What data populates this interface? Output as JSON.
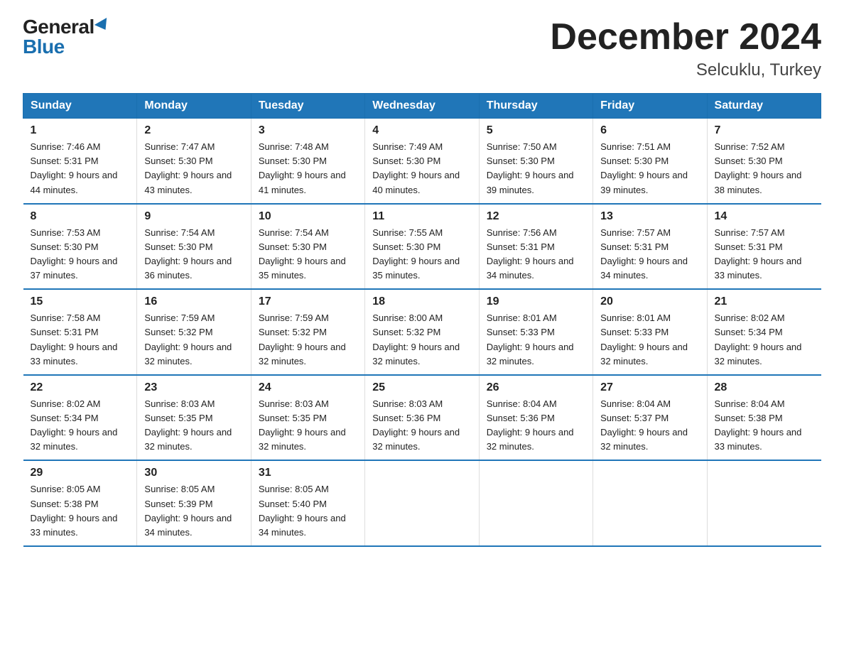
{
  "logo": {
    "general": "General",
    "blue": "Blue"
  },
  "title": "December 2024",
  "subtitle": "Selcuklu, Turkey",
  "days_header": [
    "Sunday",
    "Monday",
    "Tuesday",
    "Wednesday",
    "Thursday",
    "Friday",
    "Saturday"
  ],
  "weeks": [
    [
      {
        "day": "1",
        "sunrise": "7:46 AM",
        "sunset": "5:31 PM",
        "daylight": "9 hours and 44 minutes."
      },
      {
        "day": "2",
        "sunrise": "7:47 AM",
        "sunset": "5:30 PM",
        "daylight": "9 hours and 43 minutes."
      },
      {
        "day": "3",
        "sunrise": "7:48 AM",
        "sunset": "5:30 PM",
        "daylight": "9 hours and 41 minutes."
      },
      {
        "day": "4",
        "sunrise": "7:49 AM",
        "sunset": "5:30 PM",
        "daylight": "9 hours and 40 minutes."
      },
      {
        "day": "5",
        "sunrise": "7:50 AM",
        "sunset": "5:30 PM",
        "daylight": "9 hours and 39 minutes."
      },
      {
        "day": "6",
        "sunrise": "7:51 AM",
        "sunset": "5:30 PM",
        "daylight": "9 hours and 39 minutes."
      },
      {
        "day": "7",
        "sunrise": "7:52 AM",
        "sunset": "5:30 PM",
        "daylight": "9 hours and 38 minutes."
      }
    ],
    [
      {
        "day": "8",
        "sunrise": "7:53 AM",
        "sunset": "5:30 PM",
        "daylight": "9 hours and 37 minutes."
      },
      {
        "day": "9",
        "sunrise": "7:54 AM",
        "sunset": "5:30 PM",
        "daylight": "9 hours and 36 minutes."
      },
      {
        "day": "10",
        "sunrise": "7:54 AM",
        "sunset": "5:30 PM",
        "daylight": "9 hours and 35 minutes."
      },
      {
        "day": "11",
        "sunrise": "7:55 AM",
        "sunset": "5:30 PM",
        "daylight": "9 hours and 35 minutes."
      },
      {
        "day": "12",
        "sunrise": "7:56 AM",
        "sunset": "5:31 PM",
        "daylight": "9 hours and 34 minutes."
      },
      {
        "day": "13",
        "sunrise": "7:57 AM",
        "sunset": "5:31 PM",
        "daylight": "9 hours and 34 minutes."
      },
      {
        "day": "14",
        "sunrise": "7:57 AM",
        "sunset": "5:31 PM",
        "daylight": "9 hours and 33 minutes."
      }
    ],
    [
      {
        "day": "15",
        "sunrise": "7:58 AM",
        "sunset": "5:31 PM",
        "daylight": "9 hours and 33 minutes."
      },
      {
        "day": "16",
        "sunrise": "7:59 AM",
        "sunset": "5:32 PM",
        "daylight": "9 hours and 32 minutes."
      },
      {
        "day": "17",
        "sunrise": "7:59 AM",
        "sunset": "5:32 PM",
        "daylight": "9 hours and 32 minutes."
      },
      {
        "day": "18",
        "sunrise": "8:00 AM",
        "sunset": "5:32 PM",
        "daylight": "9 hours and 32 minutes."
      },
      {
        "day": "19",
        "sunrise": "8:01 AM",
        "sunset": "5:33 PM",
        "daylight": "9 hours and 32 minutes."
      },
      {
        "day": "20",
        "sunrise": "8:01 AM",
        "sunset": "5:33 PM",
        "daylight": "9 hours and 32 minutes."
      },
      {
        "day": "21",
        "sunrise": "8:02 AM",
        "sunset": "5:34 PM",
        "daylight": "9 hours and 32 minutes."
      }
    ],
    [
      {
        "day": "22",
        "sunrise": "8:02 AM",
        "sunset": "5:34 PM",
        "daylight": "9 hours and 32 minutes."
      },
      {
        "day": "23",
        "sunrise": "8:03 AM",
        "sunset": "5:35 PM",
        "daylight": "9 hours and 32 minutes."
      },
      {
        "day": "24",
        "sunrise": "8:03 AM",
        "sunset": "5:35 PM",
        "daylight": "9 hours and 32 minutes."
      },
      {
        "day": "25",
        "sunrise": "8:03 AM",
        "sunset": "5:36 PM",
        "daylight": "9 hours and 32 minutes."
      },
      {
        "day": "26",
        "sunrise": "8:04 AM",
        "sunset": "5:36 PM",
        "daylight": "9 hours and 32 minutes."
      },
      {
        "day": "27",
        "sunrise": "8:04 AM",
        "sunset": "5:37 PM",
        "daylight": "9 hours and 32 minutes."
      },
      {
        "day": "28",
        "sunrise": "8:04 AM",
        "sunset": "5:38 PM",
        "daylight": "9 hours and 33 minutes."
      }
    ],
    [
      {
        "day": "29",
        "sunrise": "8:05 AM",
        "sunset": "5:38 PM",
        "daylight": "9 hours and 33 minutes."
      },
      {
        "day": "30",
        "sunrise": "8:05 AM",
        "sunset": "5:39 PM",
        "daylight": "9 hours and 34 minutes."
      },
      {
        "day": "31",
        "sunrise": "8:05 AM",
        "sunset": "5:40 PM",
        "daylight": "9 hours and 34 minutes."
      },
      null,
      null,
      null,
      null
    ]
  ]
}
